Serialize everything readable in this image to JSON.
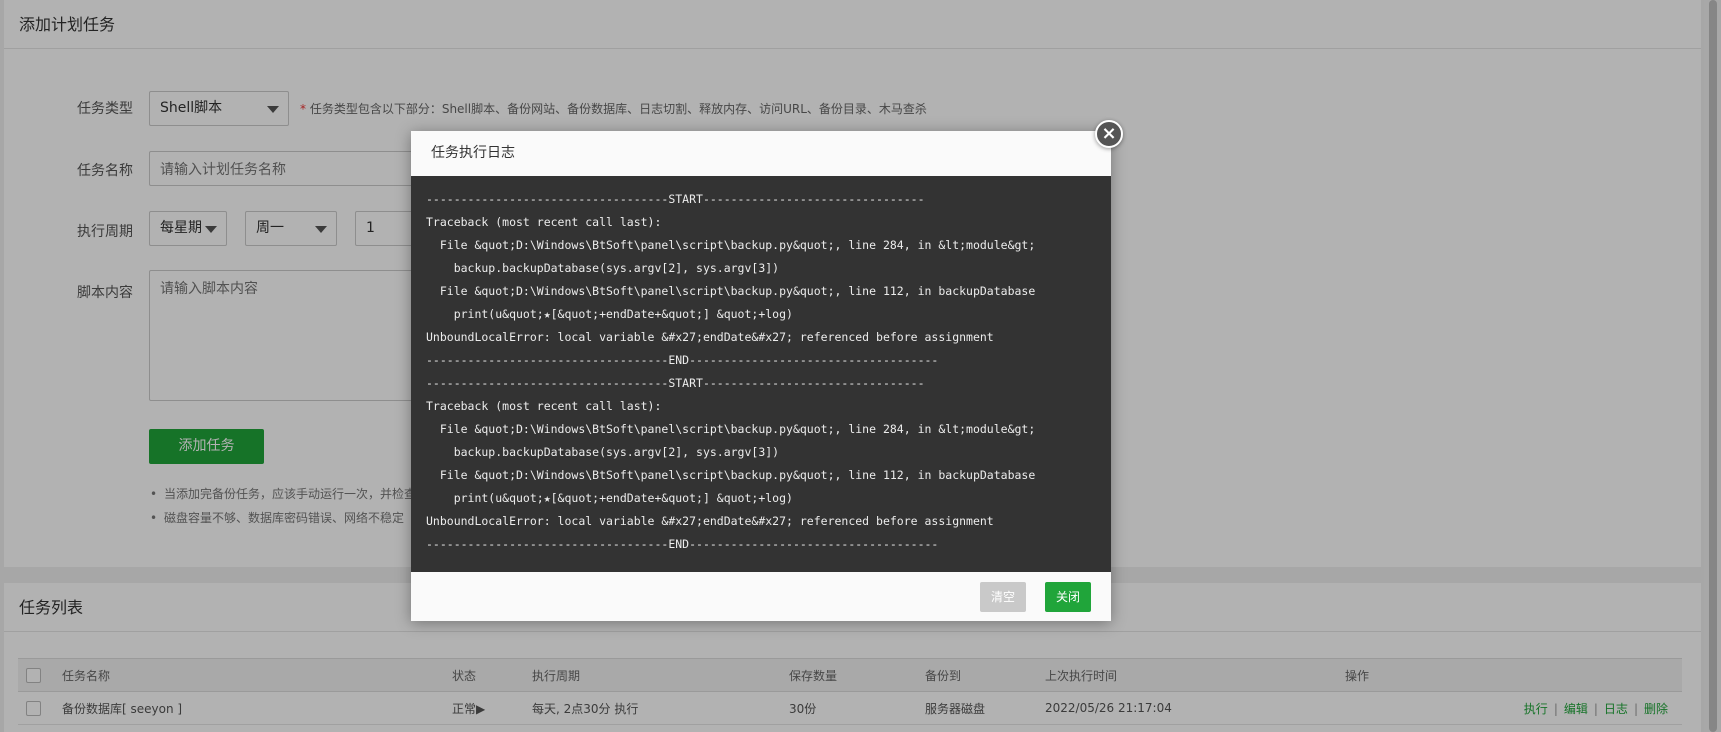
{
  "add_panel": {
    "title": "添加计划任务",
    "task_type_label": "任务类型",
    "task_type_value": "Shell脚本",
    "task_type_required_mark": "*",
    "task_type_hint": "任务类型包含以下部分：Shell脚本、备份网站、备份数据库、日志切割、释放内存、访问URL、备份目录、木马查杀",
    "task_name_label": "任务名称",
    "task_name_placeholder": "请输入计划任务名称",
    "cycle_label": "执行周期",
    "cycle_type": "每星期",
    "cycle_weekday": "周一",
    "cycle_hour": "1",
    "script_label": "脚本内容",
    "script_placeholder": "请输入脚本内容",
    "add_button": "添加任务",
    "tips": [
      "当添加完备份任务，应该手动运行一次，并检查",
      "磁盘容量不够、数据库密码错误、网络不稳定"
    ]
  },
  "task_list": {
    "title": "任务列表",
    "columns": [
      "任务名称",
      "状态",
      "执行周期",
      "保存数量",
      "备份到",
      "上次执行时间",
      "操作"
    ],
    "rows": [
      {
        "name": "备份数据库[ seeyon ]",
        "status": "正常▶",
        "cycle": "每天, 2点30分 执行",
        "keep": "30份",
        "backup_to": "服务器磁盘",
        "last_run": "2022/05/26 21:17:04",
        "ops": [
          "执行",
          "编辑",
          "日志",
          "删除"
        ]
      }
    ],
    "op_separator": "|"
  },
  "modal": {
    "title": "任务执行日志",
    "close_glyph": "×",
    "log_lines": [
      "-----------------------------------START--------------------------------",
      "Traceback (most recent call last):",
      "  File &quot;D:\\Windows\\BtSoft\\panel\\script\\backup.py&quot;, line 284, in &lt;module&gt;",
      "    backup.backupDatabase(sys.argv[2], sys.argv[3])",
      "  File &quot;D:\\Windows\\BtSoft\\panel\\script\\backup.py&quot;, line 112, in backupDatabase",
      "    print(u&quot;★[&quot;+endDate+&quot;] &quot;+log)",
      "UnboundLocalError: local variable &#x27;endDate&#x27; referenced before assignment",
      "-----------------------------------END------------------------------------",
      "-----------------------------------START--------------------------------",
      "Traceback (most recent call last):",
      "  File &quot;D:\\Windows\\BtSoft\\panel\\script\\backup.py&quot;, line 284, in &lt;module&gt;",
      "    backup.backupDatabase(sys.argv[2], sys.argv[3])",
      "  File &quot;D:\\Windows\\BtSoft\\panel\\script\\backup.py&quot;, line 112, in backupDatabase",
      "    print(u&quot;★[&quot;+endDate+&quot;] &quot;+log)",
      "UnboundLocalError: local variable &#x27;endDate&#x27; referenced before assignment",
      "-----------------------------------END------------------------------------"
    ],
    "clear_button": "清空",
    "close_button": "关闭"
  },
  "colors": {
    "accent_green": "#20a53a",
    "log_background": "#333333",
    "clear_button_bg": "#c9c9c9"
  }
}
